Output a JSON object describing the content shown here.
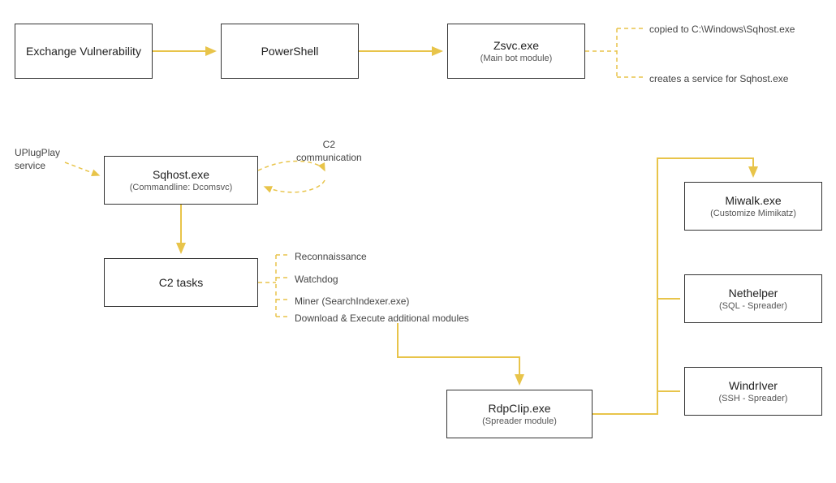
{
  "boxes": {
    "exchange": {
      "title": "Exchange Vulnerability"
    },
    "powershell": {
      "title": "PowerShell"
    },
    "zsvc": {
      "title": "Zsvc.exe",
      "sub": "(Main bot module)"
    },
    "sqhost": {
      "title": "Sqhost.exe",
      "sub": "(Commandline: Dcomsvc)"
    },
    "c2tasks": {
      "title": "C2 tasks"
    },
    "rdpclip": {
      "title": "RdpCIip.exe",
      "sub": "(Spreader module)"
    },
    "miwalk": {
      "title": "Miwalk.exe",
      "sub": "(Customize Mimikatz)"
    },
    "nethelper": {
      "title": "Nethelper",
      "sub": "(SQL - Spreader)"
    },
    "windriver": {
      "title": "WindrIver",
      "sub": "(SSH - Spreader)"
    }
  },
  "annotations": {
    "copied": "copied to C:\\Windows\\Sqhost.exe",
    "creates_service": "creates a service for Sqhost.exe",
    "uplugplay": "UPlugPlay\nservice",
    "c2comm": "C2\ncommunication",
    "tasks": {
      "recon": "Reconnaissance",
      "watchdog": "Watchdog",
      "miner": "Miner (SearchIndexer.exe)",
      "download": "Download & Execute additional modules"
    }
  },
  "colors": {
    "accent": "#e8c44a"
  }
}
